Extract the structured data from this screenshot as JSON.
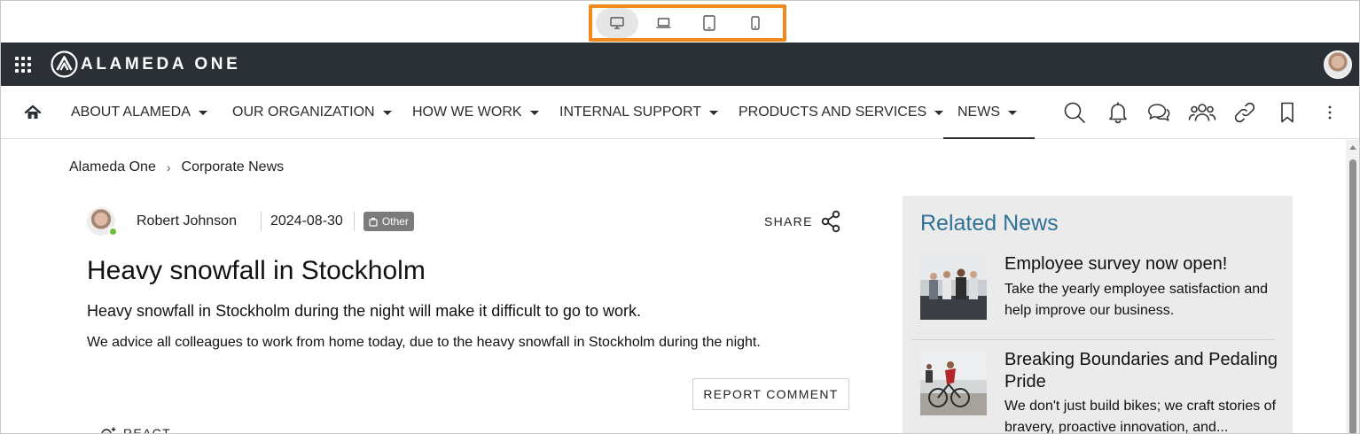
{
  "device_switcher": {
    "options": [
      {
        "name": "desktop",
        "active": true
      },
      {
        "name": "laptop",
        "active": false
      },
      {
        "name": "tablet",
        "active": false
      },
      {
        "name": "mobile",
        "active": false
      }
    ],
    "highlight_color": "#f08a1c"
  },
  "top_bar": {
    "brand": "ALAMEDA ONE",
    "background": "#2a3036"
  },
  "nav": {
    "items": [
      {
        "label": "ABOUT ALAMEDA",
        "has_dropdown": true,
        "active": false
      },
      {
        "label": "OUR ORGANIZATION",
        "has_dropdown": true,
        "active": false
      },
      {
        "label": "HOW WE WORK",
        "has_dropdown": true,
        "active": false
      },
      {
        "label": "INTERNAL SUPPORT",
        "has_dropdown": true,
        "active": false
      },
      {
        "label": "PRODUCTS AND SERVICES",
        "has_dropdown": true,
        "active": false
      },
      {
        "label": "NEWS",
        "has_dropdown": true,
        "active": true
      }
    ],
    "tools": [
      "search-icon",
      "bell-icon",
      "chat-icon",
      "people-icon",
      "link-icon",
      "bookmark-icon",
      "more-vertical-icon"
    ]
  },
  "breadcrumb": {
    "items": [
      "Alameda One",
      "Corporate News"
    ],
    "separator": "›"
  },
  "article": {
    "author": "Robert Johnson",
    "date": "2024-08-30",
    "tag": "Other",
    "share_label": "SHARE",
    "title": "Heavy snowfall in Stockholm",
    "lead": "Heavy snowfall in Stockholm during the night will make it difficult to go to work.",
    "body": "We advice all colleagues to work from home today, due to the heavy snowfall in Stockholm during the night.",
    "report_label": "REPORT COMMENT",
    "react_label": "REACT"
  },
  "related_news": {
    "title": "Related News",
    "title_color": "#2f7196",
    "items": [
      {
        "headline": "Employee survey now open!",
        "excerpt": "Take the yearly employee satisfaction and help improve our business."
      },
      {
        "headline": "Breaking Boundaries and Pedaling Pride",
        "excerpt": "We don't just build bikes; we craft stories of bravery, proactive innovation, and..."
      }
    ]
  }
}
